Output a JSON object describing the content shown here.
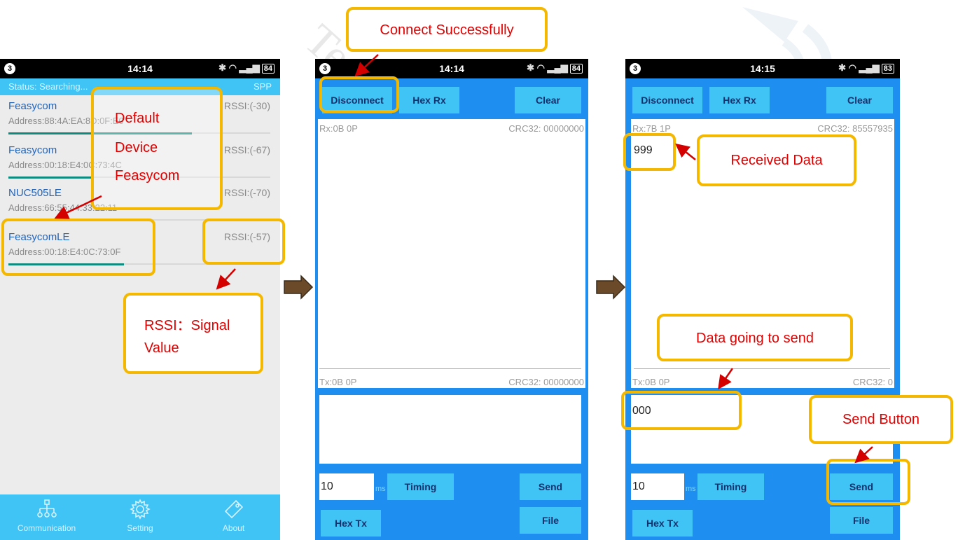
{
  "watermark": "Technology Co.,Ltd",
  "colors": {
    "accent": "#40c4f5",
    "callout_border": "#f5b800",
    "callout_text": "#e00000",
    "bar": "#0f8a7c",
    "bar_alt": "#3db34a"
  },
  "screen1": {
    "statusbar": {
      "notif_count": "3",
      "time": "14:14",
      "battery": "84"
    },
    "status_text": "Status: Searching...",
    "mode": "SPP",
    "devices": [
      {
        "name": "Feasycom",
        "address": "Address:88:4A:EA:8D:0F:E0",
        "rssi": "RSSI:(-30)",
        "signal": 0.7
      },
      {
        "name": "Feasycom",
        "address": "Address:00:18:E4:0C:73:4C",
        "rssi": "RSSI:(-67)",
        "signal": 0.32
      },
      {
        "name": "NUC505LE",
        "address": "Address:66:55:44:33:22:11",
        "rssi": "RSSI:(-70)",
        "signal": 0.3
      },
      {
        "name": "FeasycomLE",
        "address": "Address:00:18:E4:0C:73:0F",
        "rssi": "RSSI:(-57)",
        "signal": 0.44
      }
    ],
    "tabs": [
      {
        "label": "Communication",
        "icon": "network-icon"
      },
      {
        "label": "Setting",
        "icon": "gear-icon"
      },
      {
        "label": "About",
        "icon": "tag-icon"
      }
    ]
  },
  "screen2": {
    "statusbar": {
      "notif_count": "3",
      "time": "14:14",
      "battery": "84"
    },
    "disconnect_label": "Disconnect",
    "hexrx_label": "Hex Rx",
    "clear_label": "Clear",
    "rx_stats": "Rx:0B  0P",
    "rx_crc": "CRC32: 00000000",
    "rx_data": "",
    "tx_stats": "Tx:0B  0P",
    "tx_crc": "CRC32: 00000000",
    "tx_data": "",
    "interval_value": "10",
    "interval_unit": "ms",
    "timing_label": "Timing",
    "send_label": "Send",
    "hextx_label": "Hex Tx",
    "file_label": "File"
  },
  "screen3": {
    "statusbar": {
      "notif_count": "3",
      "time": "14:15",
      "battery": "83"
    },
    "disconnect_label": "Disconnect",
    "hexrx_label": "Hex Rx",
    "clear_label": "Clear",
    "rx_stats": "Rx:7B  1P",
    "rx_crc": "CRC32: 85557935",
    "rx_data": "999",
    "tx_stats": "Tx:0B  0P",
    "tx_crc": "CRC32: 0",
    "tx_data": "000",
    "interval_value": "10",
    "interval_unit": "ms",
    "timing_label": "Timing",
    "send_label": "Send",
    "hextx_label": "Hex Tx",
    "file_label": "File"
  },
  "annotations": {
    "default_device_line1": "Default",
    "default_device_line2": "Device",
    "default_device_line3": "Feasycom",
    "rssi_line1": "RSSI：Signal",
    "rssi_line2": "Value",
    "connect": "Connect Successfully",
    "received": "Received Data",
    "data_to_send": "Data going to send",
    "send_button": "Send Button"
  }
}
